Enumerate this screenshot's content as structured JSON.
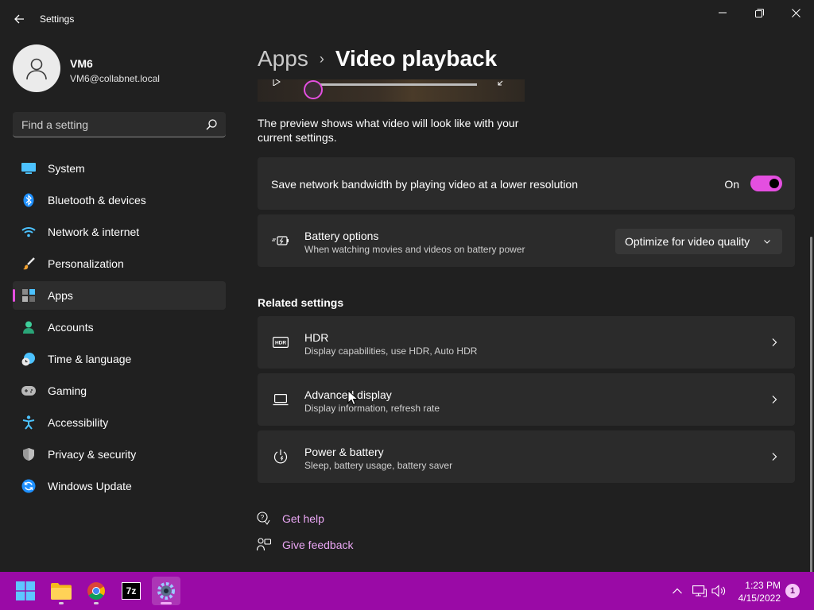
{
  "window": {
    "title": "Settings",
    "back_icon": "back-arrow-icon",
    "controls": [
      "minimize-icon",
      "maximize-icon",
      "close-icon"
    ]
  },
  "profile": {
    "name": "VM6",
    "email": "VM6@collabnet.local"
  },
  "search": {
    "placeholder": "Find a setting",
    "value": ""
  },
  "sidebar": {
    "items": [
      {
        "label": "System",
        "icon": "system-icon",
        "active": false
      },
      {
        "label": "Bluetooth & devices",
        "icon": "bluetooth-icon",
        "active": false
      },
      {
        "label": "Network & internet",
        "icon": "wifi-icon",
        "active": false
      },
      {
        "label": "Personalization",
        "icon": "paintbrush-icon",
        "active": false
      },
      {
        "label": "Apps",
        "icon": "apps-icon",
        "active": true
      },
      {
        "label": "Accounts",
        "icon": "accounts-icon",
        "active": false
      },
      {
        "label": "Time & language",
        "icon": "clock-globe-icon",
        "active": false
      },
      {
        "label": "Gaming",
        "icon": "gamepad-icon",
        "active": false
      },
      {
        "label": "Accessibility",
        "icon": "accessibility-icon",
        "active": false
      },
      {
        "label": "Privacy & security",
        "icon": "shield-icon",
        "active": false
      },
      {
        "label": "Windows Update",
        "icon": "update-icon",
        "active": false
      }
    ]
  },
  "breadcrumb": {
    "parent": "Apps",
    "separator": "›",
    "current": "Video playback"
  },
  "preview": {
    "description": "The preview shows what video will look like with your current settings."
  },
  "bandwidth": {
    "label": "Save network bandwidth by playing video at a lower resolution",
    "state_label": "On",
    "enabled": true
  },
  "battery": {
    "title": "Battery options",
    "subtitle": "When watching movies and videos on battery power",
    "selected": "Optimize for video quality"
  },
  "related": {
    "heading": "Related settings",
    "items": [
      {
        "title": "HDR",
        "subtitle": "Display capabilities, use HDR, Auto HDR",
        "icon": "hdr-icon"
      },
      {
        "title": "Advanced display",
        "subtitle": "Display information, refresh rate",
        "icon": "laptop-icon"
      },
      {
        "title": "Power & battery",
        "subtitle": "Sleep, battery usage, battery saver",
        "icon": "power-icon"
      }
    ]
  },
  "links": {
    "help": "Get help",
    "feedback": "Give feedback"
  },
  "taskbar": {
    "apps": [
      "windows-start-icon",
      "file-explorer-icon",
      "chrome-icon",
      "7zip-icon",
      "settings-gear-icon"
    ],
    "sevenzip_label": "7z",
    "time": "1:23 PM",
    "date": "4/15/2022",
    "notification_count": "1"
  },
  "colors": {
    "accent": "#e44fe0",
    "taskbar": "#9a0aa6",
    "background": "#202020",
    "card": "#2b2b2b",
    "link": "#e9a6f3"
  }
}
